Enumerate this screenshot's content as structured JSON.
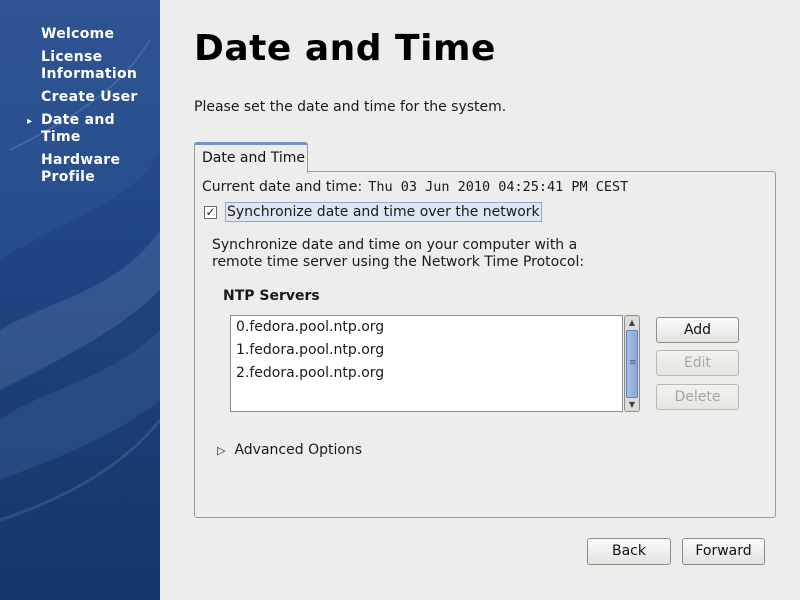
{
  "sidebar": {
    "steps": [
      {
        "label": "Welcome"
      },
      {
        "label": "License Information"
      },
      {
        "label": "Create User"
      },
      {
        "label": "Date and Time",
        "current": true
      },
      {
        "label": "Hardware Profile"
      }
    ],
    "current_marker": "▸"
  },
  "main": {
    "title": "Date and Time",
    "subtitle": "Please set the date and time for the system.",
    "tab_label": "Date and Time",
    "current_label": "Current date and time:",
    "current_value": "Thu 03 Jun 2010 04:25:41 PM CEST",
    "sync_checked": true,
    "sync_label": "Synchronize date and time over the network",
    "description_line1": "Synchronize date and time on your computer with a",
    "description_line2": "remote time server using the Network Time Protocol:",
    "ntp_title": "NTP Servers",
    "ntp_servers": [
      "0.fedora.pool.ntp.org",
      "1.fedora.pool.ntp.org",
      "2.fedora.pool.ntp.org"
    ],
    "buttons": {
      "add": "Add",
      "edit": "Edit",
      "delete": "Delete"
    },
    "advanced_label": "Advanced Options"
  },
  "footer": {
    "back": "Back",
    "forward": "Forward"
  }
}
